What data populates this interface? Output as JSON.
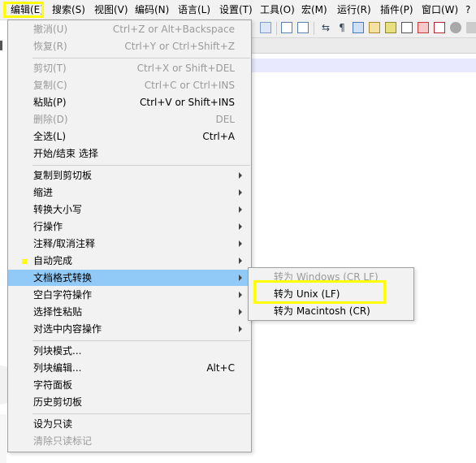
{
  "menubar": {
    "items": [
      "编辑(E)",
      "搜索(S)",
      "视图(V)",
      "编码(N)",
      "语言(L)",
      "设置(T)",
      "工具(O)",
      "宏(M)",
      "运行(R)",
      "插件(P)",
      "窗口(W)",
      "?"
    ]
  },
  "edit_menu": {
    "items": [
      {
        "label": "撤消(U)",
        "shortcut": "Ctrl+Z or Alt+Backspace",
        "disabled": true
      },
      {
        "label": "恢复(R)",
        "shortcut": "Ctrl+Y or Ctrl+Shift+Z",
        "disabled": true
      },
      {
        "label": "剪切(T)",
        "shortcut": "Ctrl+X or Shift+DEL",
        "disabled": true
      },
      {
        "label": "复制(C)",
        "shortcut": "Ctrl+C or Ctrl+INS",
        "disabled": true
      },
      {
        "label": "粘贴(P)",
        "shortcut": "Ctrl+V or Shift+INS",
        "disabled": false
      },
      {
        "label": "删除(D)",
        "shortcut": "DEL",
        "disabled": true
      },
      {
        "label": "全选(L)",
        "shortcut": "Ctrl+A",
        "disabled": false
      },
      {
        "label": "开始/结束 选择",
        "shortcut": "",
        "disabled": false
      },
      {
        "label": "复制到剪切板",
        "submenu": true
      },
      {
        "label": "缩进",
        "submenu": true
      },
      {
        "label": "转换大小写",
        "submenu": true
      },
      {
        "label": "行操作",
        "submenu": true
      },
      {
        "label": "注释/取消注释",
        "submenu": true
      },
      {
        "label": "自动完成",
        "submenu": true
      },
      {
        "label": "文档格式转换",
        "submenu": true,
        "active": true
      },
      {
        "label": "空白字符操作",
        "submenu": true
      },
      {
        "label": "选择性粘贴",
        "submenu": true
      },
      {
        "label": "对选中内容操作",
        "submenu": true
      },
      {
        "label": "列块模式...",
        "shortcut": ""
      },
      {
        "label": "列块编辑...",
        "shortcut": "Alt+C"
      },
      {
        "label": "字符面板",
        "shortcut": ""
      },
      {
        "label": "历史剪切板",
        "shortcut": ""
      },
      {
        "label": "设为只读",
        "shortcut": ""
      },
      {
        "label": "清除只读标记",
        "shortcut": "",
        "disabled": true
      }
    ]
  },
  "eol_submenu": {
    "items": [
      {
        "label": "转为 Windows (CR LF)",
        "disabled": true
      },
      {
        "label": "转为 Unix (LF)",
        "disabled": false
      },
      {
        "label": "转为 Macintosh (CR)",
        "disabled": false
      }
    ]
  },
  "colors": {
    "highlight_box": "#ffff00",
    "active_row": "#91c9f7",
    "menu_bg": "#f2f2f2"
  }
}
